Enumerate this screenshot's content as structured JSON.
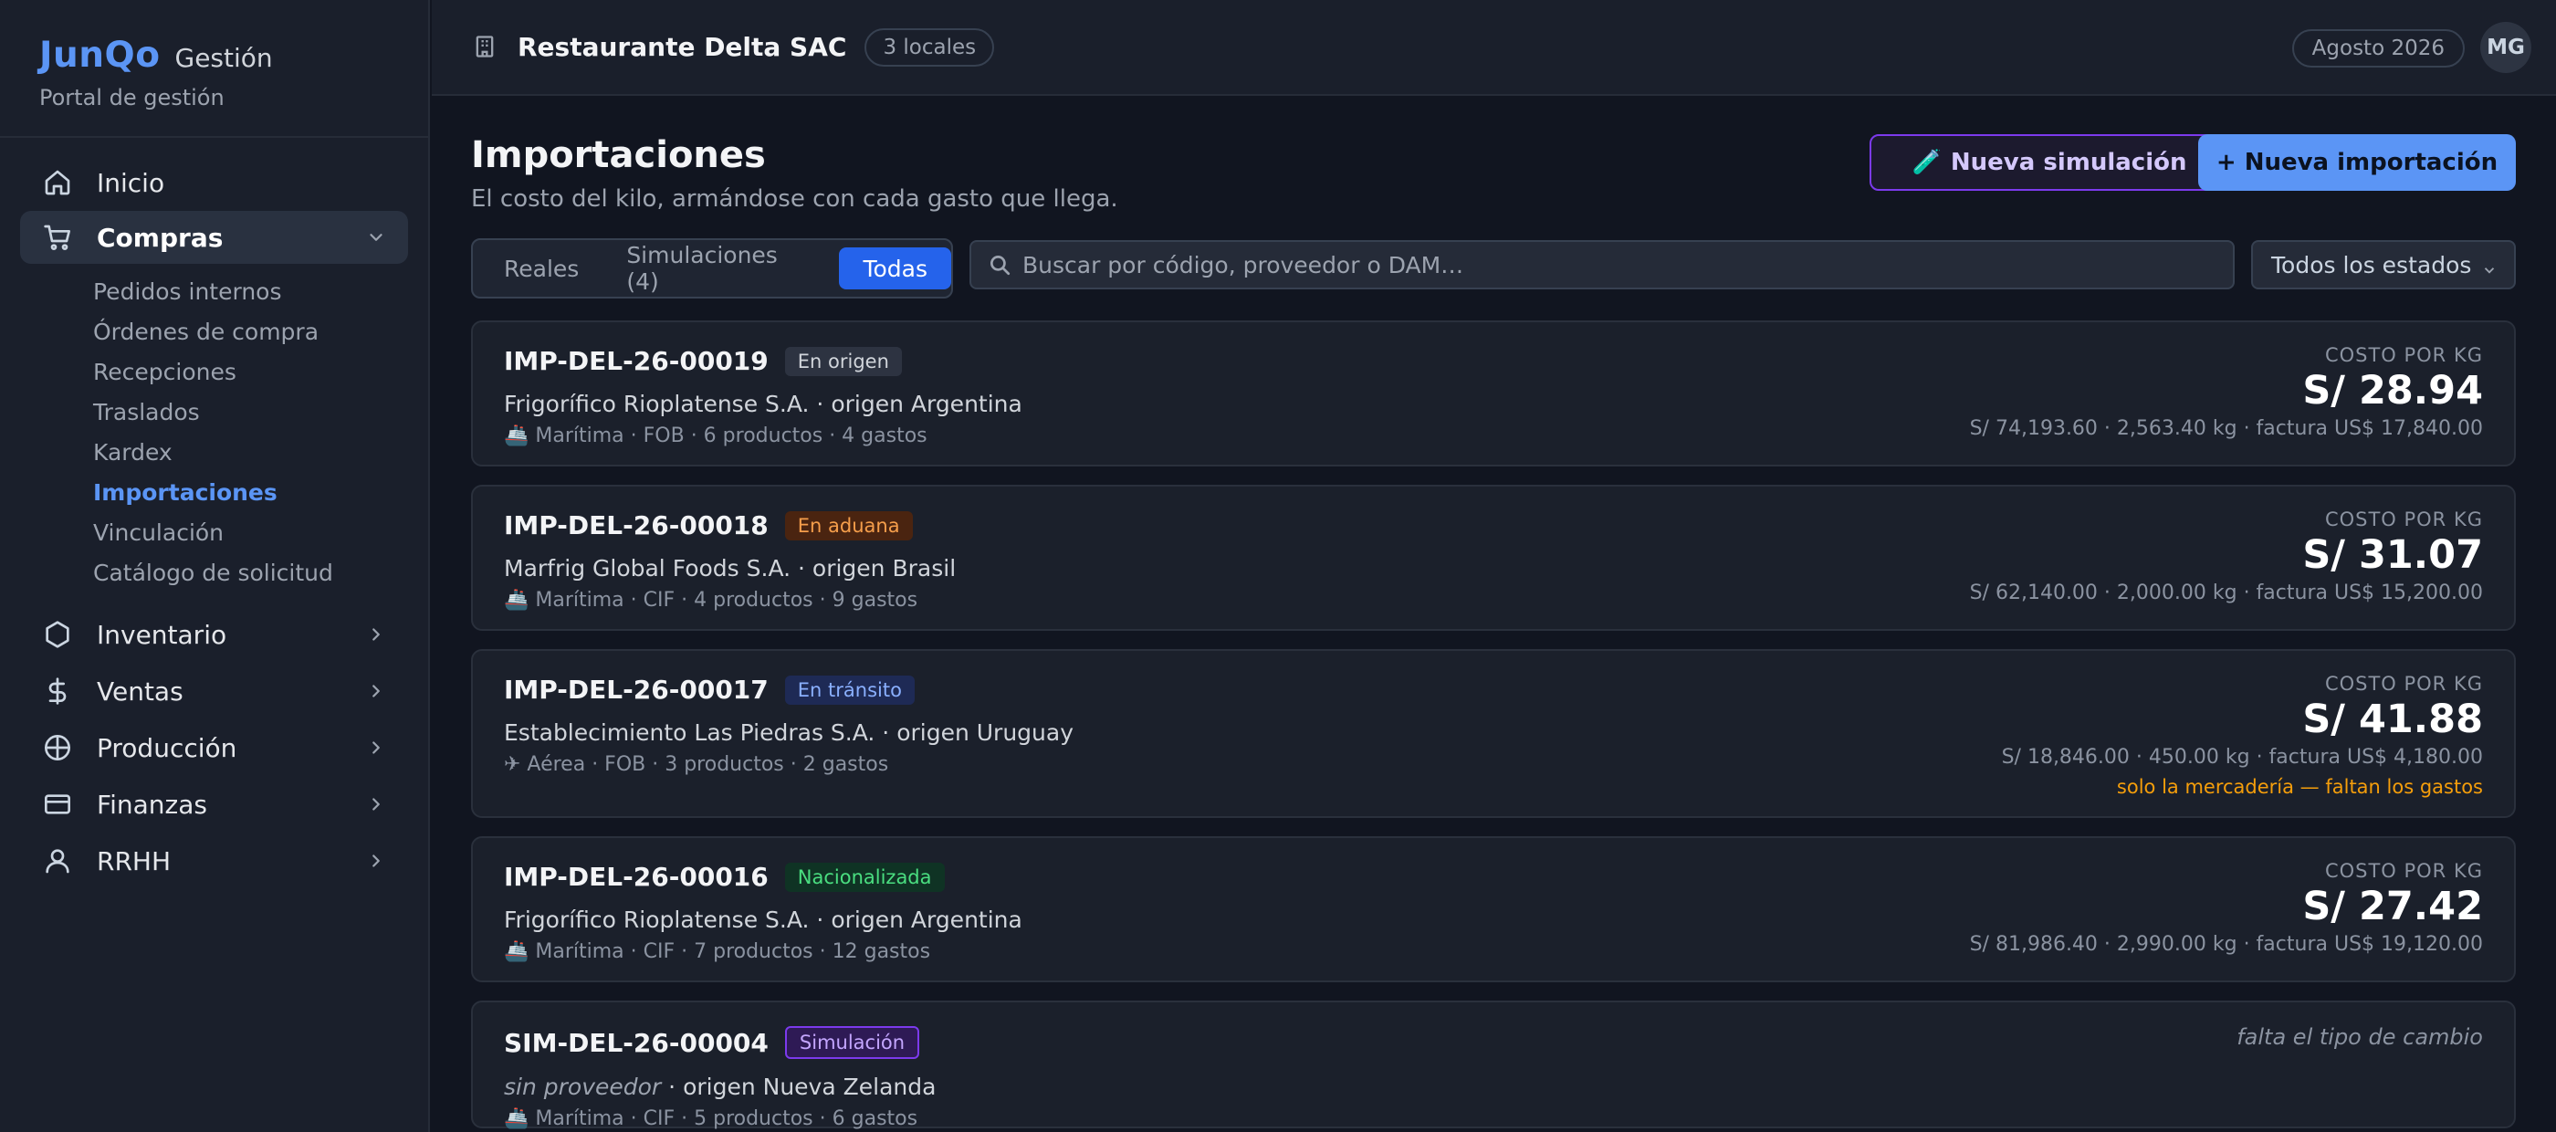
{
  "brand": {
    "name": "JunQo",
    "suffix": "Gestión",
    "tagline": "Portal de gestión"
  },
  "sidebar": {
    "items_top": [
      {
        "label": "Inicio",
        "icon": "home-icon"
      },
      {
        "label": "Compras",
        "icon": "cart-icon",
        "expanded": true
      }
    ],
    "compras_sub": [
      "Pedidos internos",
      "Órdenes de compra",
      "Recepciones",
      "Traslados",
      "Kardex",
      "Importaciones",
      "Vinculación",
      "Catálogo de solicitud"
    ],
    "active_sub": "Importaciones",
    "items_bottom": [
      {
        "label": "Inventario",
        "icon": "box-icon"
      },
      {
        "label": "Ventas",
        "icon": "dollar-icon"
      },
      {
        "label": "Producción",
        "icon": "globe-icon"
      },
      {
        "label": "Finanzas",
        "icon": "card-icon"
      },
      {
        "label": "RRHH",
        "icon": "user-icon"
      }
    ]
  },
  "topbar": {
    "org_name": "Restaurante Delta SAC",
    "locations": "3 locales",
    "period": "Agosto 2026",
    "avatar": "MG"
  },
  "page": {
    "title": "Importaciones",
    "subtitle": "El costo del kilo, armándose con cada gasto que llega.",
    "btn_simulation": "Nueva simulación",
    "btn_import": "+ Nueva importación",
    "tabs": [
      "Reales",
      "Simulaciones (4)",
      "Todas"
    ],
    "active_tab": "Todas",
    "search_placeholder": "Buscar por código, proveedor o DAM…",
    "status_filter": "Todos los estados"
  },
  "imports": [
    {
      "code": "IMP-DEL-26-00019",
      "status": "En origen",
      "supplier": "Frigorífico Rioplatense S.A.",
      "origin": "· origen Argentina",
      "meta": "🚢 Marítima · FOB · 6 productos · 4 gastos",
      "cost_label": "COSTO POR KG",
      "cost": "S/ 28.94",
      "totals": "S/ 74,193.60 · 2,563.40 kg · factura US$ 17,840.00"
    },
    {
      "code": "IMP-DEL-26-00018",
      "status": "En aduana",
      "supplier": "Marfrig Global Foods S.A.",
      "origin": "· origen Brasil",
      "meta": "🚢 Marítima · CIF · 4 productos · 9 gastos",
      "cost_label": "COSTO POR KG",
      "cost": "S/ 31.07",
      "totals": "S/ 62,140.00 · 2,000.00 kg · factura US$ 15,200.00"
    },
    {
      "code": "IMP-DEL-26-00017",
      "status": "En tránsito",
      "supplier": "Establecimiento Las Piedras S.A.",
      "origin": "· origen Uruguay",
      "meta": "✈ Aérea · FOB · 3 productos · 2 gastos",
      "cost_label": "COSTO POR KG",
      "cost": "S/ 41.88",
      "totals": "S/ 18,846.00 · 450.00 kg · factura US$ 4,180.00",
      "warning": "solo la mercadería — faltan los gastos"
    },
    {
      "code": "IMP-DEL-26-00016",
      "status": "Nacionalizada",
      "supplier": "Frigorífico Rioplatense S.A.",
      "origin": "· origen Argentina",
      "meta": "🚢 Marítima · CIF · 7 productos · 12 gastos",
      "cost_label": "COSTO POR KG",
      "cost": "S/ 27.42",
      "totals": "S/ 81,986.40 · 2,990.00 kg · factura US$ 19,120.00"
    },
    {
      "code": "SIM-DEL-26-00004",
      "status": "Simulación",
      "supplier": "sin proveedor",
      "origin": "· origen Nueva Zelanda",
      "meta": "🚢 Marítima · CIF · 5 productos · 6 gastos",
      "note": "falta el tipo de cambio"
    }
  ]
}
